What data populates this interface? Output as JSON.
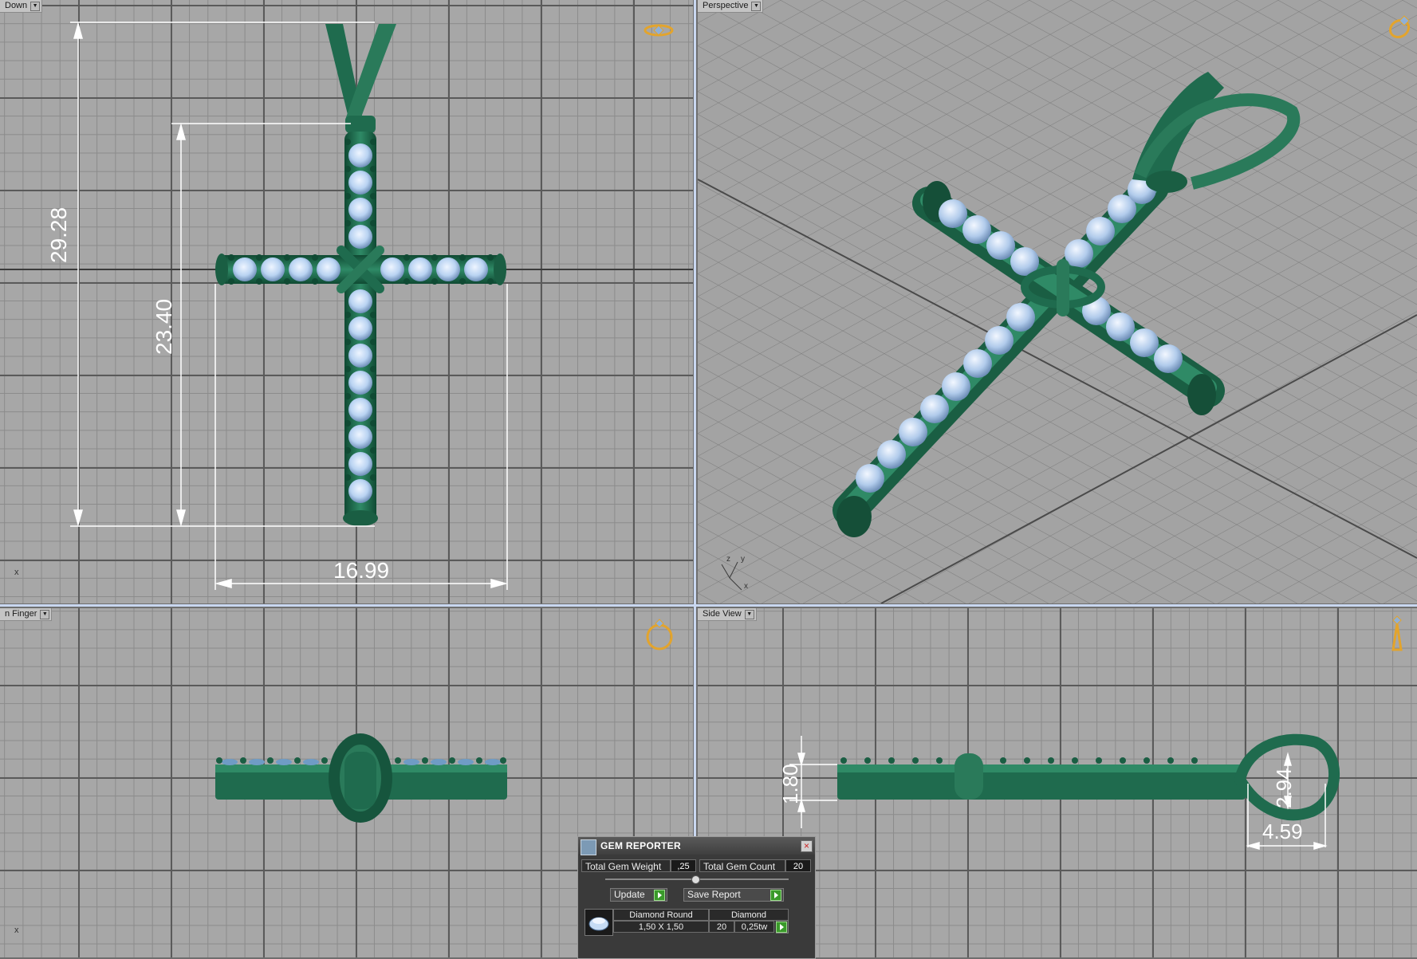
{
  "viewports": {
    "top_left": {
      "label": "Down",
      "dims": {
        "height_total": "29.28",
        "height_cross": "23.40",
        "width": "16.99"
      },
      "axis_mark": "x"
    },
    "top_right": {
      "label": "Perspective",
      "axis": {
        "x": "x",
        "y": "y",
        "z": "z"
      }
    },
    "bottom_left": {
      "label": "n Finger",
      "axis_mark": "x"
    },
    "bottom_right": {
      "label": "Side View",
      "dims": {
        "thickness": "1.80",
        "bail_height": "2.94",
        "bail_width": "4.59"
      }
    }
  },
  "gem_reporter": {
    "title": "GEM REPORTER",
    "total_weight_label": "Total Gem Weight",
    "total_weight_value": ",25",
    "total_count_label": "Total Gem Count",
    "total_count_value": "20",
    "update_label": "Update",
    "save_label": "Save Report",
    "row": {
      "name": "Diamond Round",
      "size": "1,50 X 1,50",
      "material": "Diamond",
      "count": "20",
      "weight": "0,25tw"
    }
  },
  "colors": {
    "metal": "#1f6b4e",
    "metal_light": "#2f8a66",
    "gem": "#b9d3f2",
    "dim_lines": "#ffffff",
    "icon": "#e3a42c"
  }
}
